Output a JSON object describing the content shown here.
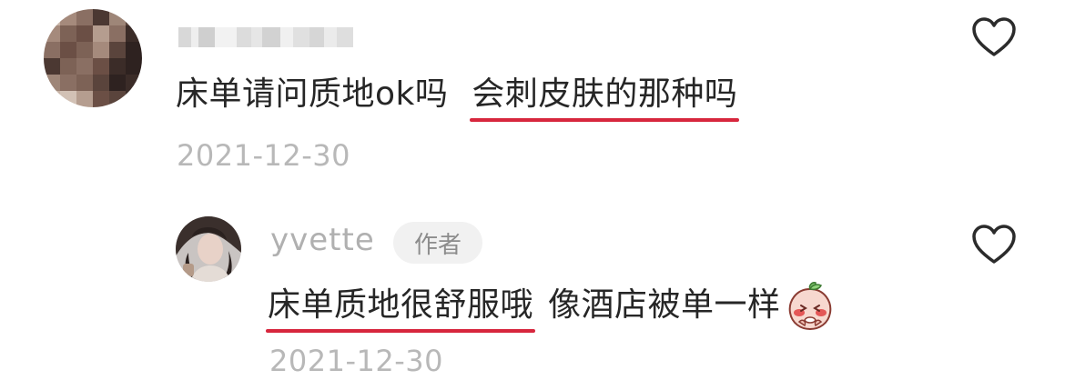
{
  "comment": {
    "username": "",
    "text_plain": "床单请问质地ok吗",
    "text_highlight": "会刺皮肤的那种吗",
    "date": "2021-12-30",
    "like_icon": "heart-outline-icon"
  },
  "reply": {
    "username": "yvette",
    "author_badge": "作者",
    "text_highlight": "床单质地很舒服哦",
    "text_plain": "像酒店被单一样",
    "emoji_icon": "peach-shy-emoji-icon",
    "date": "2021-12-30",
    "like_icon": "heart-outline-icon"
  },
  "colors": {
    "text": "#262626",
    "meta": "#b8b8b8",
    "underline": "#d7263d",
    "badge_bg": "#f1f1f1"
  }
}
